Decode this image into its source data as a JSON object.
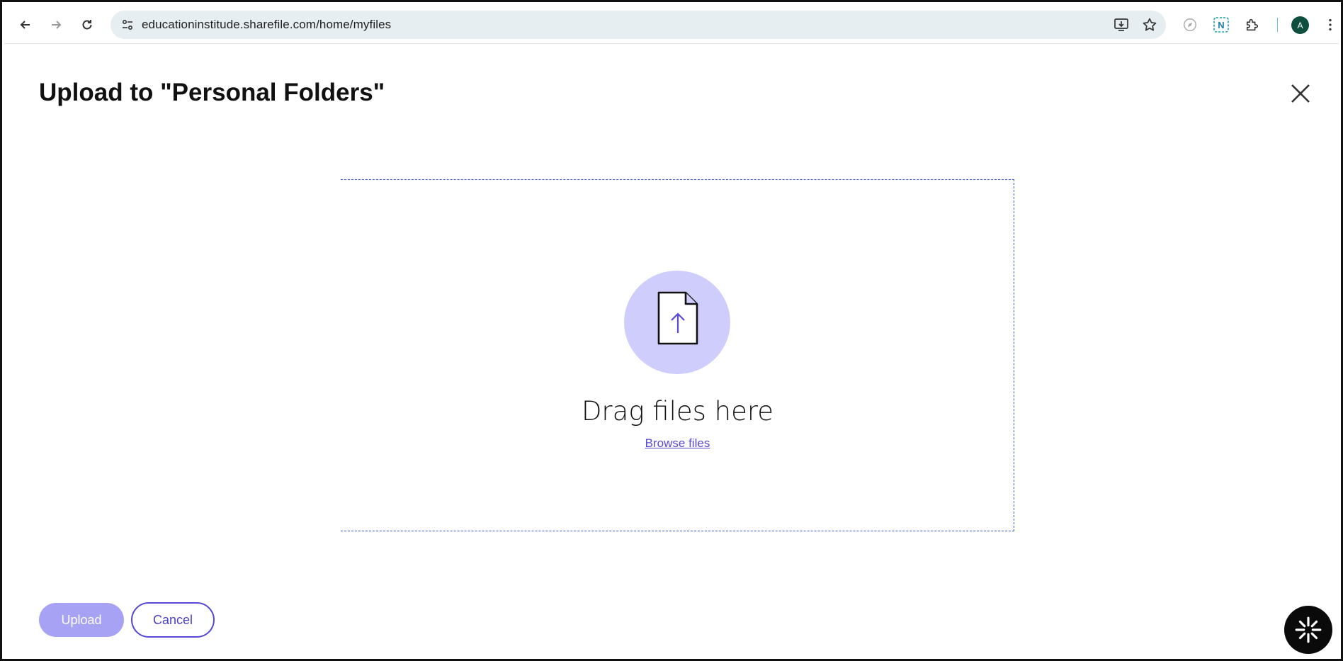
{
  "browser": {
    "url": "educationinstitude.sharefile.com/home/myfiles",
    "avatar_letter": "A",
    "icons": [
      "back-icon",
      "forward-icon",
      "reload-icon",
      "site-info-icon",
      "install-app-icon",
      "bookmark-star-icon",
      "compass-extension-icon",
      "n-extension-icon",
      "extensions-puzzle-icon",
      "kebab-menu-icon"
    ]
  },
  "dialog": {
    "title": "Upload to \"Personal Folders\"",
    "close_icon": "close-icon"
  },
  "dropzone": {
    "icon": "file-upload-icon",
    "drag_text": "Drag files here",
    "browse_label": "Browse files"
  },
  "actions": {
    "upload_label": "Upload",
    "cancel_label": "Cancel"
  },
  "colors": {
    "accent": "#5548d6",
    "upload_disabled": "#a8a2f5",
    "circle_bg": "#cfcdfb",
    "dropzone_border": "#3b5bc4"
  }
}
